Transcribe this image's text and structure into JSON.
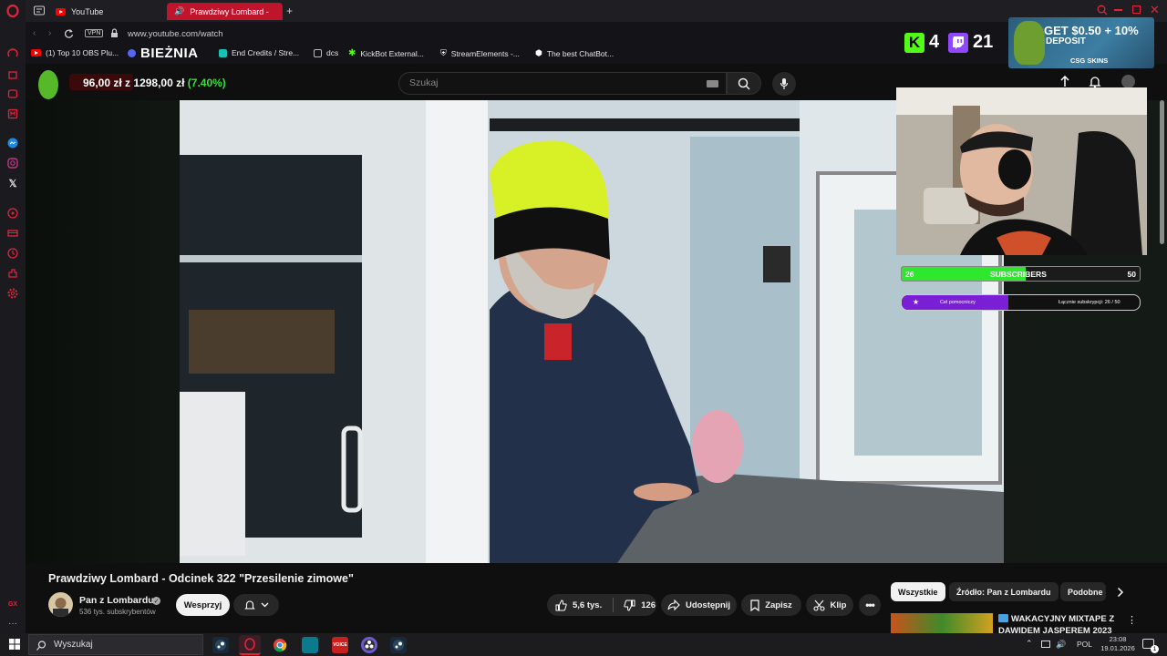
{
  "browser": {
    "tabs": [
      {
        "label": "YouTube"
      },
      {
        "label": "Prawdziwy Lombard -"
      }
    ],
    "new_tab": "+",
    "url": "www.youtube.com/watch",
    "vpn": "VPN",
    "bookmarks": [
      {
        "label": "(1) Top 10 OBS Plu..."
      },
      {
        "label": "BIEŻNIA"
      },
      {
        "label": "End Credits / Stre..."
      },
      {
        "label": "dcs"
      },
      {
        "label": "KickBot External..."
      },
      {
        "label": "StreamElements -..."
      },
      {
        "label": "The best ChatBot..."
      }
    ]
  },
  "overlay": {
    "ticker_amount": "96,00 zł",
    "ticker_of": "z",
    "ticker_total": "1298,00 zł",
    "ticker_pct": "(7.40%)",
    "kick_count": "4",
    "twitch_count": "21",
    "ad_title": "GET $0.50 + 10%",
    "ad_sub": "DEPOSIT",
    "ad_brand": "CSG SKINS",
    "subs_current": "26",
    "subs_label": "SUBSCRIBERS",
    "subs_goal": "50",
    "subs_fraction": 0.52,
    "goal_left": "Cel pomocniczy",
    "goal_right": "Łącznie subskrypcji: 26 / 50",
    "goal_fraction": 0.45
  },
  "youtube": {
    "search_placeholder": "Szukaj",
    "video_title": "Prawdziwy Lombard - Odcinek 322 \"Przesilenie zimowe\"",
    "channel_name": "Pan z Lombardu",
    "channel_subs": "536 tys. subskrybentów",
    "support_button": "Wesprzyj",
    "likes": "5,6 tys.",
    "dislikes": "126",
    "share": "Udostępnij",
    "save": "Zapisz",
    "clip": "Klip",
    "chips": [
      {
        "label": "Wszystkie"
      },
      {
        "label": "Źródło: Pan z Lombardu"
      },
      {
        "label": "Podobne"
      }
    ],
    "rec_title_1": "WAKACYJNY MIXTAPE Z",
    "rec_title_2": "DAWIDEM JASPEREM 2023"
  },
  "taskbar": {
    "search": "Wyszukaj",
    "lang": "POL",
    "time": "23:08",
    "date": "19.01.2026",
    "notif_count": "1"
  },
  "colors": {
    "opera_red": "#e0243c",
    "yt_red": "#ff0000",
    "subs_green": "#2ee82e",
    "goal_purple": "#7a1fd6",
    "ticker_green": "#3ddc3d"
  }
}
